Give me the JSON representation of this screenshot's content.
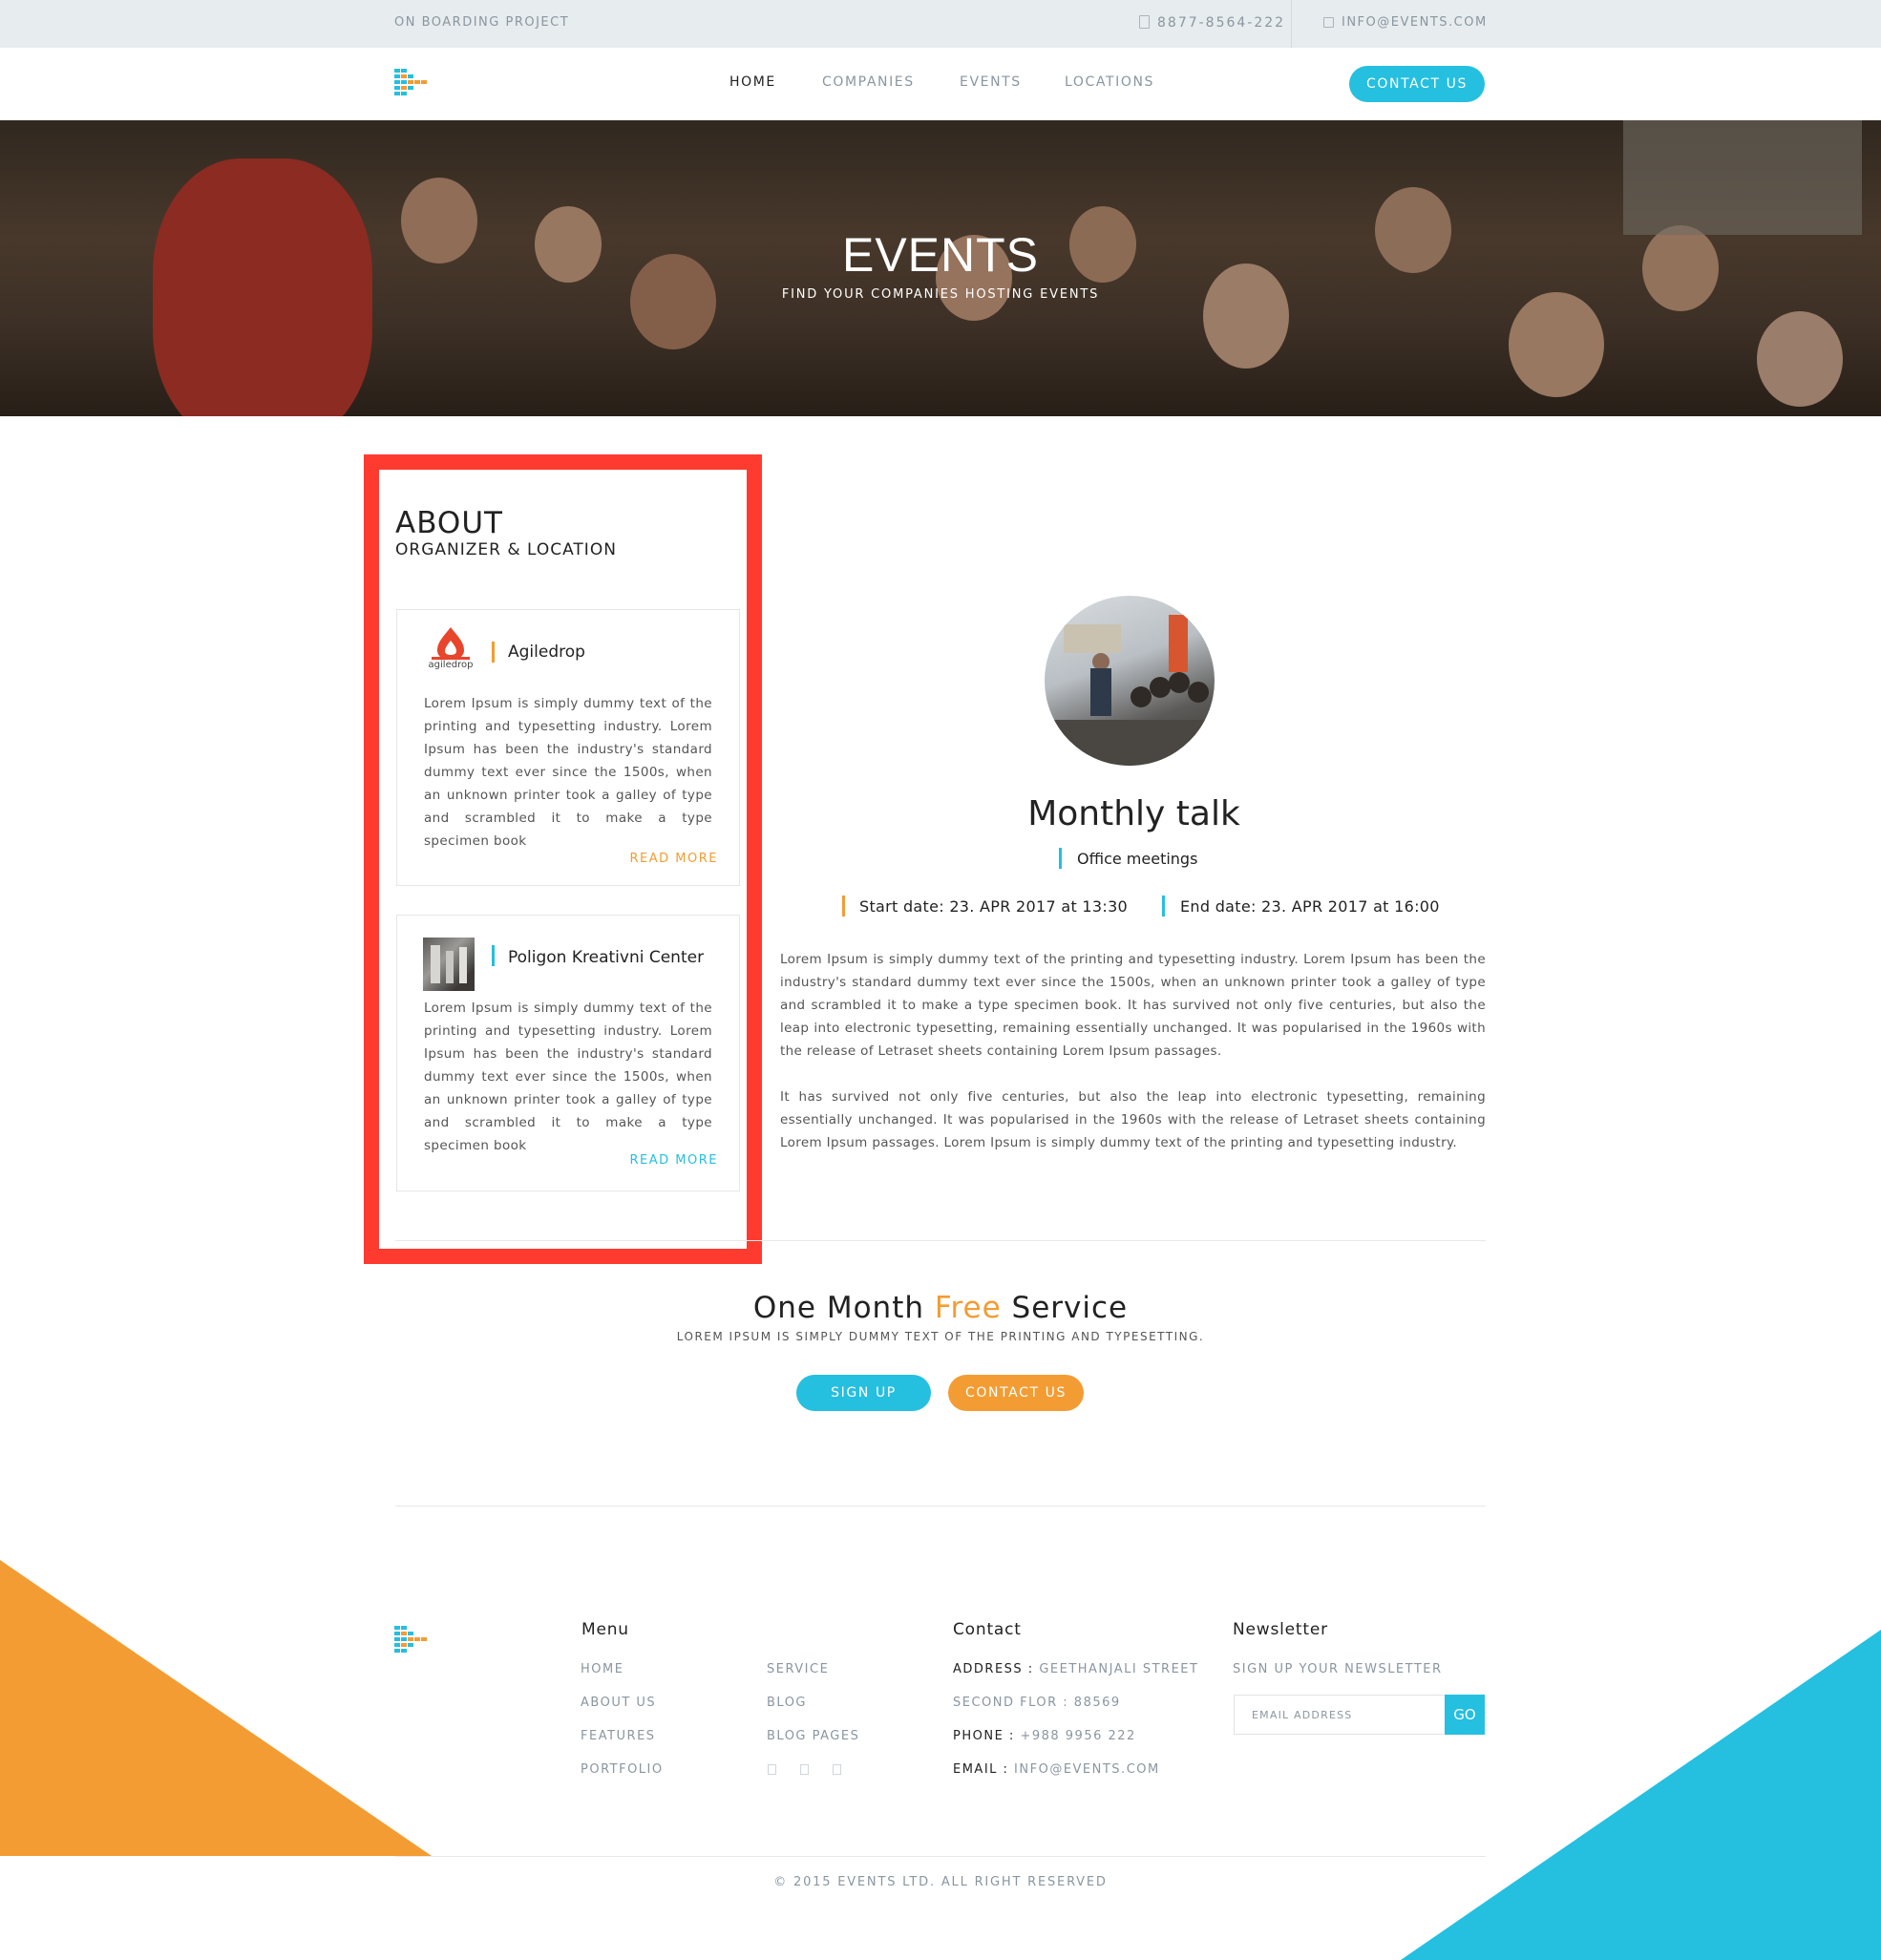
{
  "topbar": {
    "brand": "ON BOARDING PROJECT",
    "phone": "8877-8564-222",
    "email": "INFO@EVENTS.COM",
    "phone_icon": "phone-icon",
    "email_icon": "mail-icon"
  },
  "nav": {
    "items": [
      {
        "label": "HOME",
        "active": true
      },
      {
        "label": "COMPANIES",
        "active": false
      },
      {
        "label": "EVENTS",
        "active": false
      },
      {
        "label": "LOCATIONS",
        "active": false
      }
    ],
    "contact_label": "CONTACT US"
  },
  "hero": {
    "title": "EVENTS",
    "subtitle": "FIND YOUR COMPANIES HOSTING EVENTS"
  },
  "about": {
    "title": "ABOUT",
    "subtitle": "ORGANIZER & LOCATION",
    "cards": [
      {
        "name": "Agiledrop",
        "logo_text": "agiledrop",
        "text": "Lorem Ipsum is simply dummy text of the printing and typesetting industry. Lorem Ipsum has been the industry's standard dummy text ever since the 1500s, when an unknown printer took a galley of type and scrambled it to make a type specimen book",
        "more": "READ MORE"
      },
      {
        "name": "Poligon Kreativni Center",
        "text": "Lorem Ipsum is simply dummy text of the printing and typesetting industry. Lorem Ipsum has been the industry's standard dummy text ever since the 1500s, when an unknown printer took a galley of type and scrambled it to make a type specimen book",
        "more": "READ MORE"
      }
    ]
  },
  "event": {
    "title": "Monthly talk",
    "type": "Office meetings",
    "start": "Start date: 23. APR 2017 at 13:30",
    "end": "End date: 23. APR 2017 at 16:00",
    "desc1": "Lorem Ipsum is simply dummy text of the printing and typesetting industry. Lorem Ipsum has been the industry's standard dummy text ever since the 1500s, when an unknown printer took a galley of type and scrambled it to make a type specimen book. It has survived not only five centuries, but also the leap into electronic typesetting, remaining essentially unchanged. It was popularised in the 1960s with the release of Letraset sheets containing Lorem Ipsum passages.",
    "desc2": "It has survived not only five centuries, but also the leap into electronic typesetting, remaining essentially unchanged. It was popularised in the 1960s with the release of Letraset sheets containing Lorem Ipsum passages. Lorem Ipsum is simply dummy text of the printing and typesetting industry."
  },
  "cta": {
    "title_pre": "One Month ",
    "title_free": "Free",
    "title_post": " Service",
    "subtitle": "LOREM IPSUM IS SIMPLY DUMMY TEXT OF THE PRINTING AND TYPESETTING.",
    "signup": "SIGN UP",
    "contact": "CONTACT US"
  },
  "footer": {
    "menu_title": "Menu",
    "menu_col1": [
      "HOME",
      "ABOUT US",
      "FEATURES",
      "PORTFOLIO"
    ],
    "menu_col2": [
      "SERVICE",
      "BLOG",
      "BLOG PAGES"
    ],
    "social_icons": [
      "facebook-icon",
      "twitter-icon",
      "linkedin-icon"
    ],
    "contact_title": "Contact",
    "address_key": "ADDRESS :",
    "address_val": " GEETHANJALI STREET",
    "address2": "SECOND FLOR : 88569",
    "phone_key": "PHONE :",
    "phone_val": " +988 9956 222",
    "email_key": "EMAIL :",
    "email_val": " INFO@EVENTS.COM",
    "newsletter_title": "Newsletter",
    "newsletter_sub": "SIGN UP YOUR NEWSLETTER",
    "email_placeholder": "EMAIL ADDRESS",
    "go": "GO",
    "copyright": "© 2015 EVENTS LTD. ALL RIGHT RESERVED"
  },
  "colors": {
    "accent_blue": "#25bfe0",
    "accent_orange": "#f39c33",
    "highlight_red": "#ff3b30"
  }
}
